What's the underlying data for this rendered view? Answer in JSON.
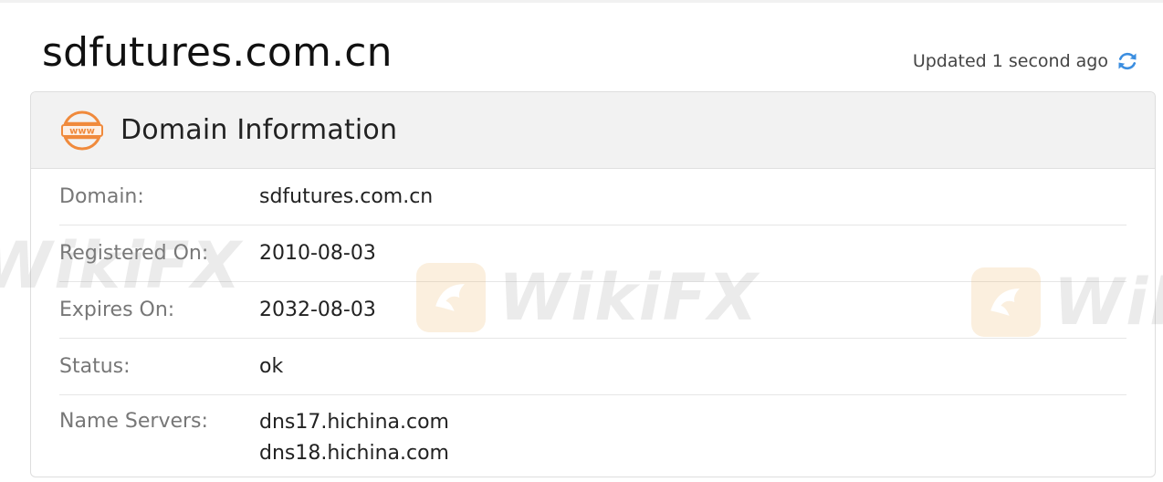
{
  "page": {
    "title": "sdfutures.com.cn",
    "updated_text": "Updated 1 second ago"
  },
  "card": {
    "title": "Domain Information",
    "rows": [
      {
        "label": "Domain:",
        "value": "sdfutures.com.cn"
      },
      {
        "label": "Registered On:",
        "value": "2010-08-03"
      },
      {
        "label": "Expires On:",
        "value": "2032-08-03"
      },
      {
        "label": "Status:",
        "value": "ok"
      },
      {
        "label": "Name Servers:",
        "values": [
          "dns17.hichina.com",
          "dns18.hichina.com"
        ]
      }
    ]
  },
  "watermark": {
    "text_1": "WikiFX",
    "text_2": "WikiFX",
    "text_3": "WikiFX"
  },
  "icons": {
    "refresh": "refresh-icon",
    "www": "www-icon"
  },
  "colors": {
    "accent_blue": "#3b8ee0",
    "www_orange": "#f08a3c"
  }
}
